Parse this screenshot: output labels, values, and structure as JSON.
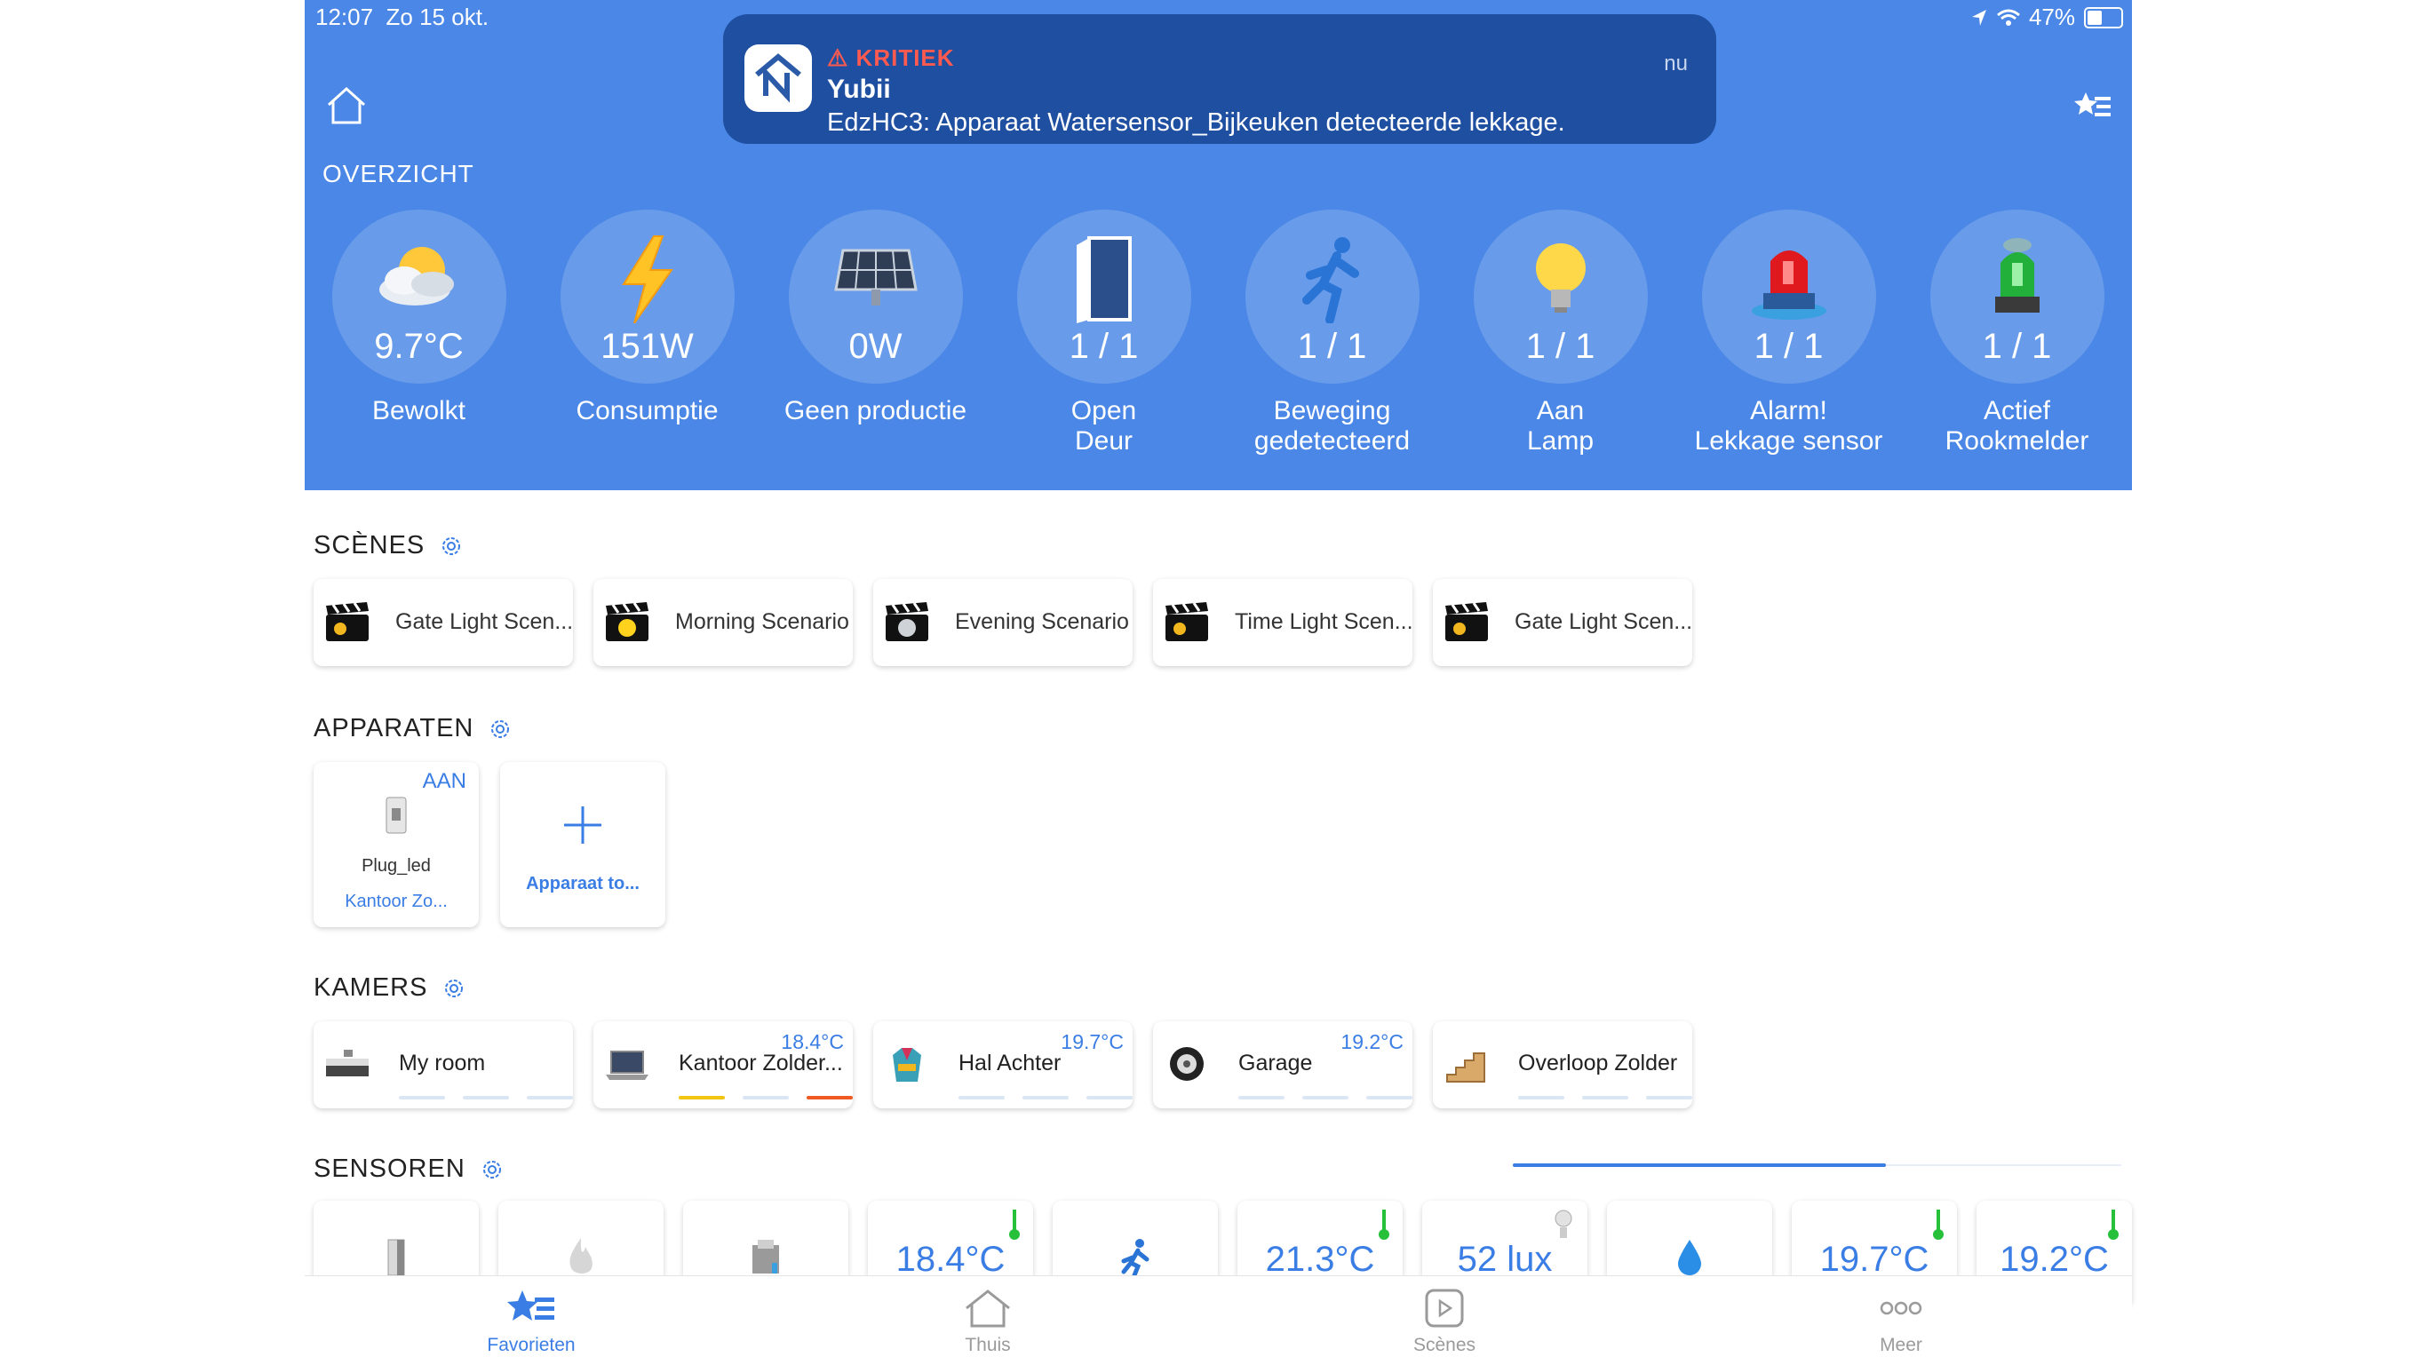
{
  "status": {
    "time": "12:07",
    "date": "Zo 15 okt.",
    "battery": "47%",
    "battery_level": 0.47
  },
  "notification": {
    "severity": "KRITIEK",
    "app": "Yubii",
    "message": "EdzHC3: Apparaat Watersensor_Bijkeuken detecteerde lekkage.",
    "time": "nu"
  },
  "overview": {
    "title": "OVERZICHT",
    "items": [
      {
        "value": "9.7°C",
        "label": "Bewolkt",
        "icon": "weather-cloudy-icon"
      },
      {
        "value": "151W",
        "label": "Consumptie",
        "icon": "lightning-icon"
      },
      {
        "value": "0W",
        "label": "Geen productie",
        "icon": "solar-panel-icon"
      },
      {
        "value": "1 / 1",
        "label": "Open",
        "label2": "Deur",
        "icon": "door-icon"
      },
      {
        "value": "1 / 1",
        "label": "Beweging",
        "label2": "gedetecteerd",
        "icon": "motion-icon"
      },
      {
        "value": "1 / 1",
        "label": "Aan",
        "label2": "Lamp",
        "icon": "bulb-icon"
      },
      {
        "value": "1 / 1",
        "label": "Alarm!",
        "label2": "Lekkage sensor",
        "icon": "red-siren-icon"
      },
      {
        "value": "1 / 1",
        "label": "Actief",
        "label2": "Rookmelder",
        "icon": "green-siren-icon"
      }
    ]
  },
  "scenes": {
    "title": "SCÈNES",
    "items": [
      {
        "label": "Gate Light Scen..."
      },
      {
        "label": "Morning Scenario"
      },
      {
        "label": "Evening Scenario"
      },
      {
        "label": "Time Light Scen..."
      },
      {
        "label": "Gate Light Scen..."
      }
    ]
  },
  "devices": {
    "title": "APPARATEN",
    "items": [
      {
        "state": "AAN",
        "name": "Plug_led",
        "room": "Kantoor Zo..."
      }
    ],
    "add_label": "Apparaat to..."
  },
  "rooms": {
    "title": "KAMERS",
    "items": [
      {
        "name": "My room",
        "temp": ""
      },
      {
        "name": "Kantoor Zolder...",
        "temp": "18.4°C"
      },
      {
        "name": "Hal Achter",
        "temp": "19.7°C"
      },
      {
        "name": "Garage",
        "temp": "19.2°C"
      },
      {
        "name": "Overloop Zolder",
        "temp": ""
      }
    ]
  },
  "sensors": {
    "title": "SENSOREN",
    "values": [
      "18.4°C",
      "21.3°C",
      "52 lux",
      "19.7°C",
      "19.2°C"
    ]
  },
  "tabs": [
    {
      "label": "Favorieten",
      "icon": "favorites-icon",
      "active": true
    },
    {
      "label": "Thuis",
      "icon": "house-icon"
    },
    {
      "label": "Scènes",
      "icon": "play-icon"
    },
    {
      "label": "Meer",
      "icon": "more-icon"
    }
  ],
  "colors": {
    "header": "#4a87e6",
    "accent": "#3a7de4",
    "notification": "#1f4fa0",
    "critical": "#ff5a4f"
  }
}
